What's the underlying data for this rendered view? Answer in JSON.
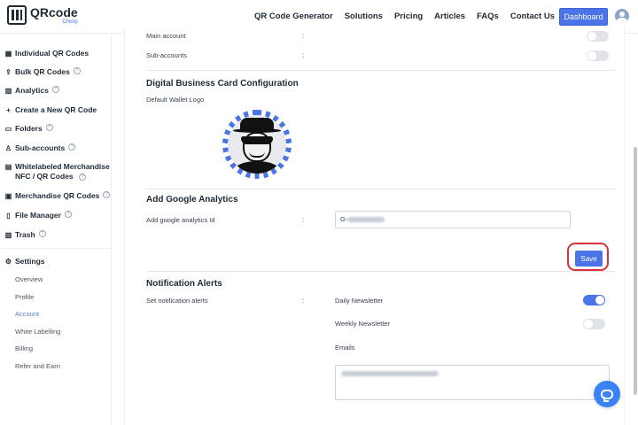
{
  "brand": {
    "title": "QRcode",
    "subtitle": "Chimp"
  },
  "nav": {
    "items": [
      "QR Code Generator",
      "Solutions",
      "Pricing",
      "Articles",
      "FAQs",
      "Contact Us"
    ],
    "dashboard_label": "Dashboard"
  },
  "sidebar": {
    "items": [
      {
        "label": "Individual QR Codes",
        "icon": "qr-icon"
      },
      {
        "label": "Bulk QR Codes",
        "icon": "upload-icon"
      },
      {
        "label": "Analytics",
        "icon": "bar-chart-icon"
      },
      {
        "label": "Create a New QR Code",
        "icon": "plus-icon"
      },
      {
        "label": "Folders",
        "icon": "folder-icon"
      },
      {
        "label": "Sub-accounts",
        "icon": "user-icon"
      },
      {
        "label_line1": "Whitelabeled Merchandise",
        "label_line2": "NFC / QR Codes",
        "icon": "merch-icon"
      },
      {
        "label": "Merchandise QR Codes",
        "icon": "tag-icon"
      },
      {
        "label": "File Manager",
        "icon": "file-icon"
      },
      {
        "label": "Trash",
        "icon": "trash-icon"
      }
    ],
    "settings_label": "Settings",
    "settings_sub": [
      "Overview",
      "Profile",
      "Account",
      "White Labelling",
      "Billing",
      "Refer and Earn"
    ],
    "active_sub": "Account"
  },
  "main": {
    "main_account_label": "Main account",
    "sub_accounts_label": "Sub-accounts",
    "colon": ":",
    "dbc_title": "Digital Business Card Configuration",
    "wallet_logo_label": "Default Wallet Logo",
    "ga_title": "Add Google Analytics",
    "ga_label": "Add google analytics Id",
    "ga_prefix": "G-",
    "save_label": "Save",
    "notif_title": "Notification Alerts",
    "notif_label": "Set notification alerts",
    "daily_label": "Daily Newsletter",
    "weekly_label": "Weekly Newsletter",
    "emails_label": "Emails",
    "toggles": {
      "main_account": false,
      "sub_accounts": false,
      "daily": true,
      "weekly": false
    }
  },
  "colors": {
    "accent": "#4a74e8",
    "highlight_ring": "#d9313b"
  }
}
